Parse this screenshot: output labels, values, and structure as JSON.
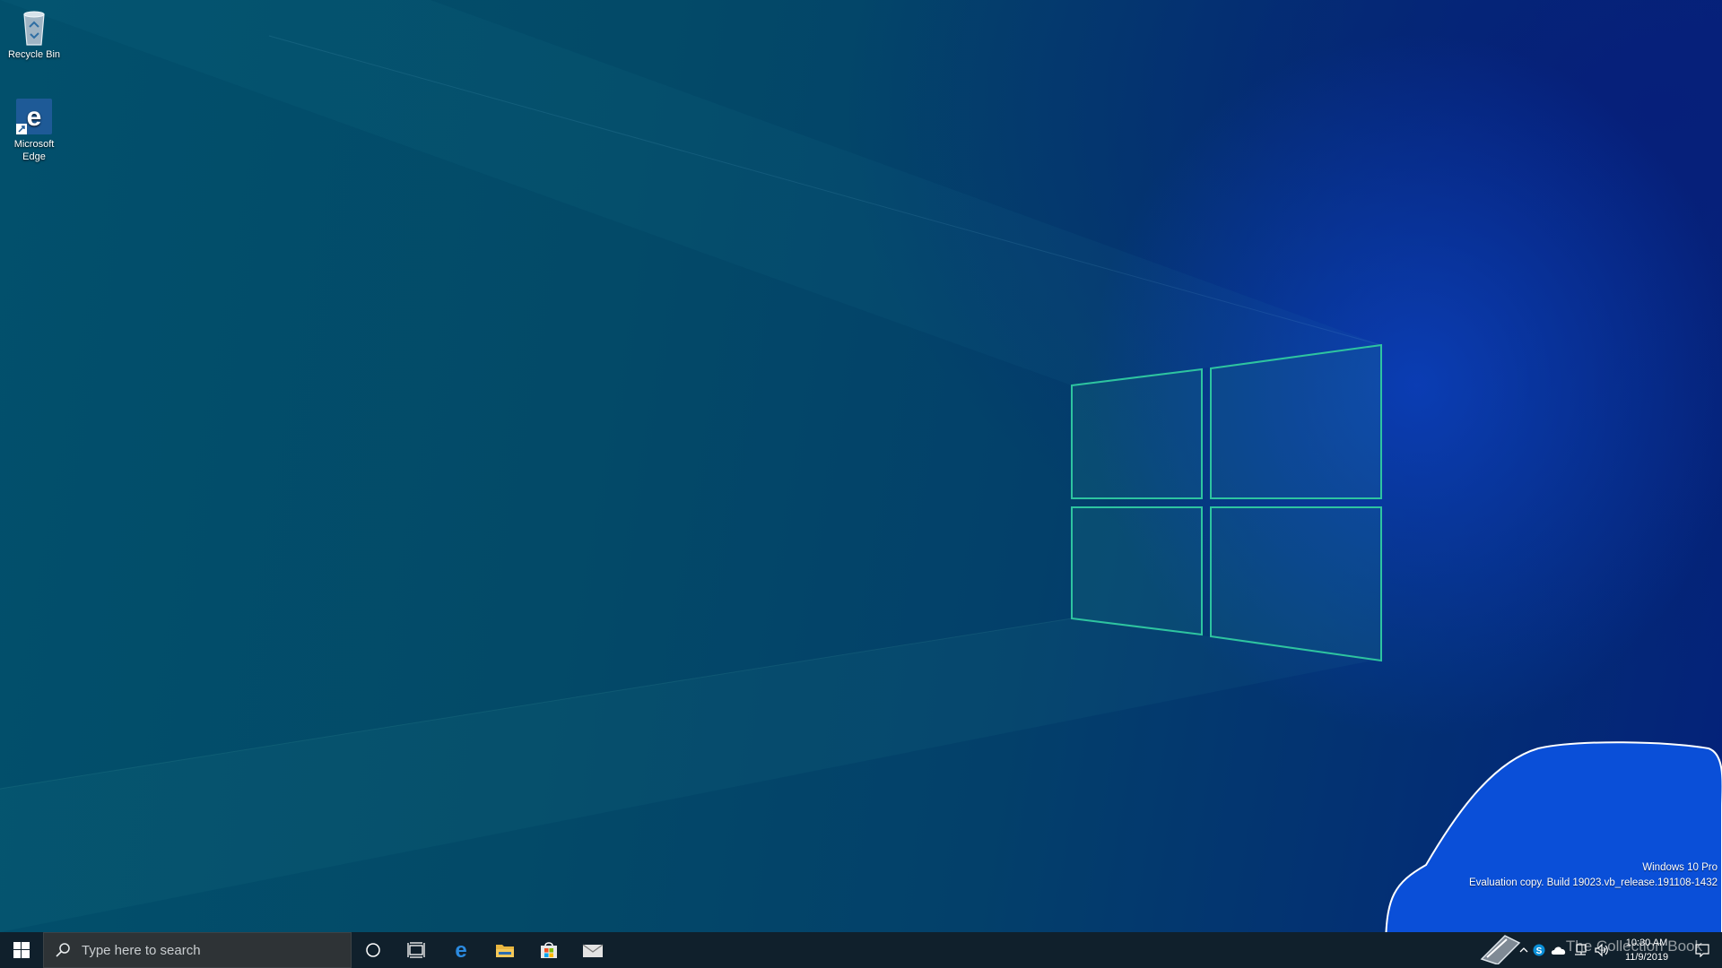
{
  "desktop": {
    "icons": [
      {
        "label": "Recycle Bin",
        "icon": "recycle-bin-icon"
      },
      {
        "label": "Microsoft Edge",
        "icon": "edge-icon"
      }
    ],
    "watermark": {
      "edition": "Windows 10 Pro",
      "build": "Evaluation copy. Build 19023.vb_release.191108-1432"
    },
    "overlay_text": "The Collection Book"
  },
  "taskbar": {
    "start": "windows-start-icon",
    "search_placeholder": "Type here to search",
    "pinned": [
      "cortana-circle-icon",
      "task-view-icon",
      "edge-icon",
      "file-explorer-icon",
      "store-icon",
      "mail-icon"
    ],
    "tray": {
      "time": "10:30 AM",
      "date": "11/9/2019",
      "icons": [
        "show-hidden-chevron-icon",
        "skype-icon",
        "onedrive-icon",
        "network-icon",
        "volume-icon",
        "action-center-icon"
      ]
    }
  },
  "colors": {
    "taskbar": "#10202c",
    "search_box": "#2e3336",
    "highlight_blob": "#0a4fd8",
    "window_logo_stroke": "#2ec4a0"
  }
}
